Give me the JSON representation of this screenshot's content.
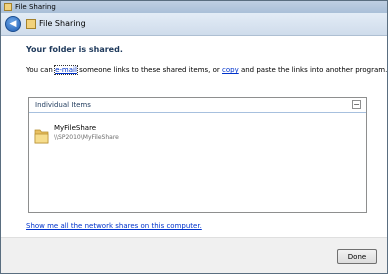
{
  "window": {
    "title": "File Sharing"
  },
  "nav": {
    "title": "File Sharing"
  },
  "content": {
    "heading": "Your folder is shared.",
    "desc_pre": "You can ",
    "email_link": "e-mail",
    "desc_mid": " someone links to these shared items, or ",
    "copy_link": "copy",
    "desc_post": " and paste the links into another program."
  },
  "items": {
    "group_label": "Individual Items",
    "collapse_symbol": "−",
    "entry": {
      "name": "MyFileShare",
      "path": "\\\\SP2010\\MyFileShare"
    }
  },
  "show_link": "Show me all the network shares on this computer.",
  "footer": {
    "done_label": "Done"
  }
}
